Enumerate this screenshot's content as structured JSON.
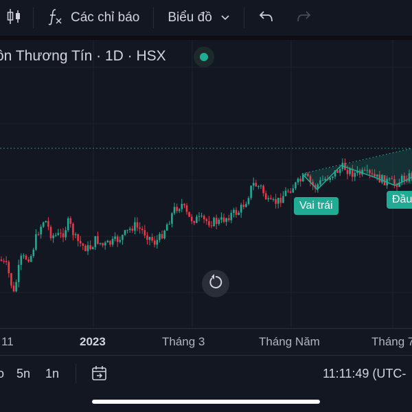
{
  "toolbar": {
    "indicators_label": "Các chỉ báo",
    "chart_type_label": "Biểu đồ",
    "icons": [
      "candlestick-icon",
      "function-icon",
      "chevron-down-icon",
      "undo-icon",
      "redo-icon"
    ]
  },
  "chart": {
    "symbol_title": "ồn Thương Tín · 1D · HSX",
    "pattern_labels": {
      "left_shoulder": "Vai trái",
      "head": "Đầu"
    },
    "colors": {
      "up": "#22ab94",
      "down": "#f23645",
      "pattern": "#22ab94",
      "background": "#131722",
      "grid": "#1f2330"
    }
  },
  "x_axis": {
    "labels": [
      "11",
      "2023",
      "Tháng 3",
      "Tháng Năm",
      "Tháng 7"
    ]
  },
  "bottom_bar": {
    "ranges": [
      "o",
      "5n",
      "1n"
    ],
    "clock": "11:11:49 (UTC-"
  }
}
